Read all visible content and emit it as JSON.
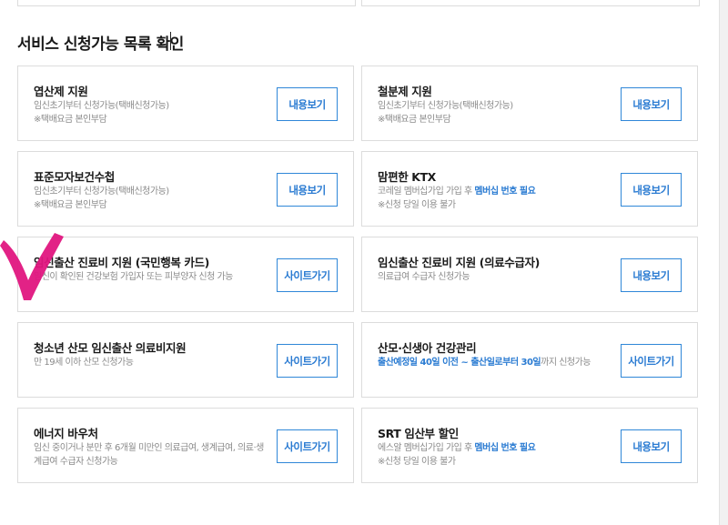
{
  "section_title": "서비스 신청가능 목록 확인",
  "cards": [
    {
      "title": "엽산제 지원",
      "lines": [
        [
          {
            "t": "임신초기부터 신청가능(택배신청가능)",
            "hl": false
          }
        ],
        [
          {
            "t": "※택배요금 본인부담",
            "hl": false
          }
        ]
      ],
      "button": "내용보기"
    },
    {
      "title": "철분제 지원",
      "lines": [
        [
          {
            "t": "임신초기부터 신청가능(택배신청가능)",
            "hl": false
          }
        ],
        [
          {
            "t": "※택배요금 본인부담",
            "hl": false
          }
        ]
      ],
      "button": "내용보기"
    },
    {
      "title": "표준모자보건수첩",
      "lines": [
        [
          {
            "t": "임신초기부터 신청가능(택배신청가능)",
            "hl": false
          }
        ],
        [
          {
            "t": "※택배요금 본인부담",
            "hl": false
          }
        ]
      ],
      "button": "내용보기"
    },
    {
      "title": "맘편한 KTX",
      "lines": [
        [
          {
            "t": "코레일 멤버십가입 가입 후 ",
            "hl": false
          },
          {
            "t": "멤버십 번호 필요",
            "hl": true
          }
        ],
        [
          {
            "t": "※신청 당일 이용 불가",
            "hl": false
          }
        ]
      ],
      "button": "내용보기"
    },
    {
      "title": "임신출산 진료비 지원 (국민행복 카드)",
      "lines": [
        [
          {
            "t": "임신이 확인된 건강보험 가입자 또는 피부양자 신청 가능",
            "hl": false
          }
        ]
      ],
      "button": "사이트가기"
    },
    {
      "title": "임신출산 진료비 지원 (의료수급자)",
      "lines": [
        [
          {
            "t": "의료급여 수급자 신청가능",
            "hl": false
          }
        ]
      ],
      "button": "내용보기"
    },
    {
      "title": "청소년 산모 임신출산 의료비지원",
      "lines": [
        [
          {
            "t": "만 19세 이하 산모 신청가능",
            "hl": false
          }
        ]
      ],
      "button": "사이트가기"
    },
    {
      "title": "산모·신생아 건강관리",
      "lines": [
        [
          {
            "t": "출산예정일 40일 이전 ~ 출산일로부터 30일",
            "hl": true
          },
          {
            "t": "까지 신청가능",
            "hl": false
          }
        ]
      ],
      "button": "사이트가기"
    },
    {
      "title": "에너지 바우처",
      "lines": [
        [
          {
            "t": "임신 중이거나 분만 후 6개월 미만인 의료급여, 생계급여, 의료·생계급여 수급자 신청가능",
            "hl": false
          }
        ]
      ],
      "button": "사이트가기"
    },
    {
      "title": "SRT 임산부 할인",
      "lines": [
        [
          {
            "t": "에스알 멤버십가입 가입 후 ",
            "hl": false
          },
          {
            "t": "멤버십 번호 필요",
            "hl": true
          }
        ],
        [
          {
            "t": "※신청 당일 이용 불가",
            "hl": false
          }
        ]
      ],
      "button": "내용보기"
    }
  ],
  "colors": {
    "accent": "#2a7bd2",
    "border": "#dcdcdc",
    "check_mark": "#e0167f"
  }
}
